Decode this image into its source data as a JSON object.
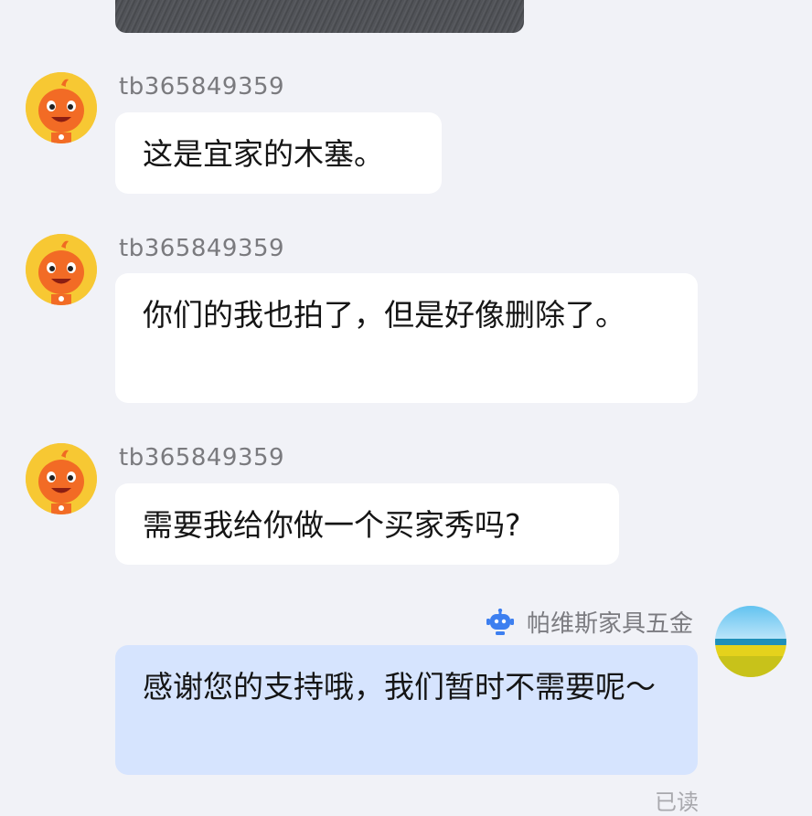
{
  "messages": [
    {
      "sender": "tb365849359",
      "text": "这是宜家的木塞。"
    },
    {
      "sender": "tb365849359",
      "text": "你们的我也拍了，但是好像删除了。"
    },
    {
      "sender": "tb365849359",
      "text": "需要我给你做一个买家秀吗?"
    }
  ],
  "reply": {
    "sender": "帕维斯家具五金",
    "text": "感谢您的支持哦，我们暂时不需要呢～",
    "status": "已读",
    "sender_badge_icon": "robot-icon"
  },
  "colors": {
    "background": "#f1f2f7",
    "bubble_incoming": "#ffffff",
    "bubble_outgoing": "#d6e4fe",
    "bot_icon": "#3d7ff0"
  }
}
